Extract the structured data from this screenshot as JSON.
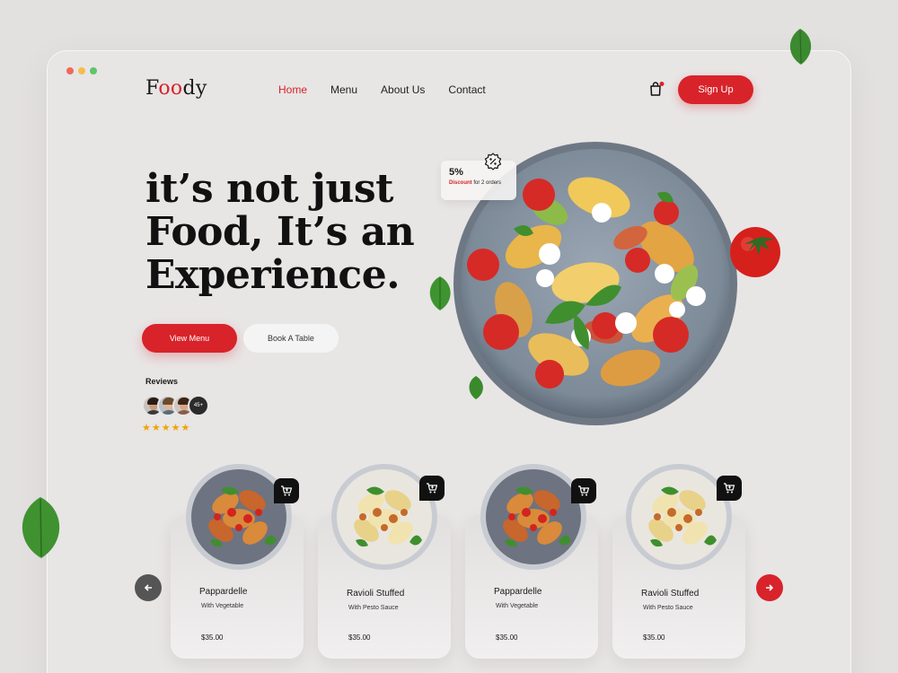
{
  "brand": {
    "logo_f": "F",
    "logo_oo": "oo",
    "logo_dy": "dy"
  },
  "window": {
    "dots": [
      "#ef6a5a",
      "#f4bd4f",
      "#5fc569"
    ]
  },
  "nav": {
    "items": [
      "Home",
      "Menu",
      "About Us",
      "Contact"
    ],
    "active": "Home",
    "signup": "Sign Up",
    "cart_icon": "shopping-bag-icon"
  },
  "hero": {
    "title_lines": [
      "it’s not just",
      "Food, It’s an",
      "Experience."
    ],
    "primary_button": "View Menu",
    "secondary_button": "Book A Table",
    "reviews_label": "Reviews",
    "reviewer_count": "45+",
    "rating": 5
  },
  "discount": {
    "percent": "5%",
    "highlight": "Discount",
    "text": "for 2 orders",
    "icon": "percent-badge-icon"
  },
  "colors": {
    "accent": "#d8232a",
    "dark": "#111111",
    "star": "#f0a500"
  },
  "cards": [
    {
      "name": "Pappardelle",
      "sub": "With Vegetable",
      "price": "$35.00",
      "dish": "red"
    },
    {
      "name": "Ravioli Stuffed",
      "sub": "With Pesto Sauce",
      "price": "$35.00",
      "dish": "yellow"
    },
    {
      "name": "Pappardelle",
      "sub": "With Vegetable",
      "price": "$35.00",
      "dish": "red"
    },
    {
      "name": "Ravioli Stuffed",
      "sub": "With Pesto Sauce",
      "price": "$35.00",
      "dish": "yellow"
    }
  ],
  "carousel": {
    "prev_icon": "arrow-left-icon",
    "next_icon": "arrow-right-icon"
  }
}
